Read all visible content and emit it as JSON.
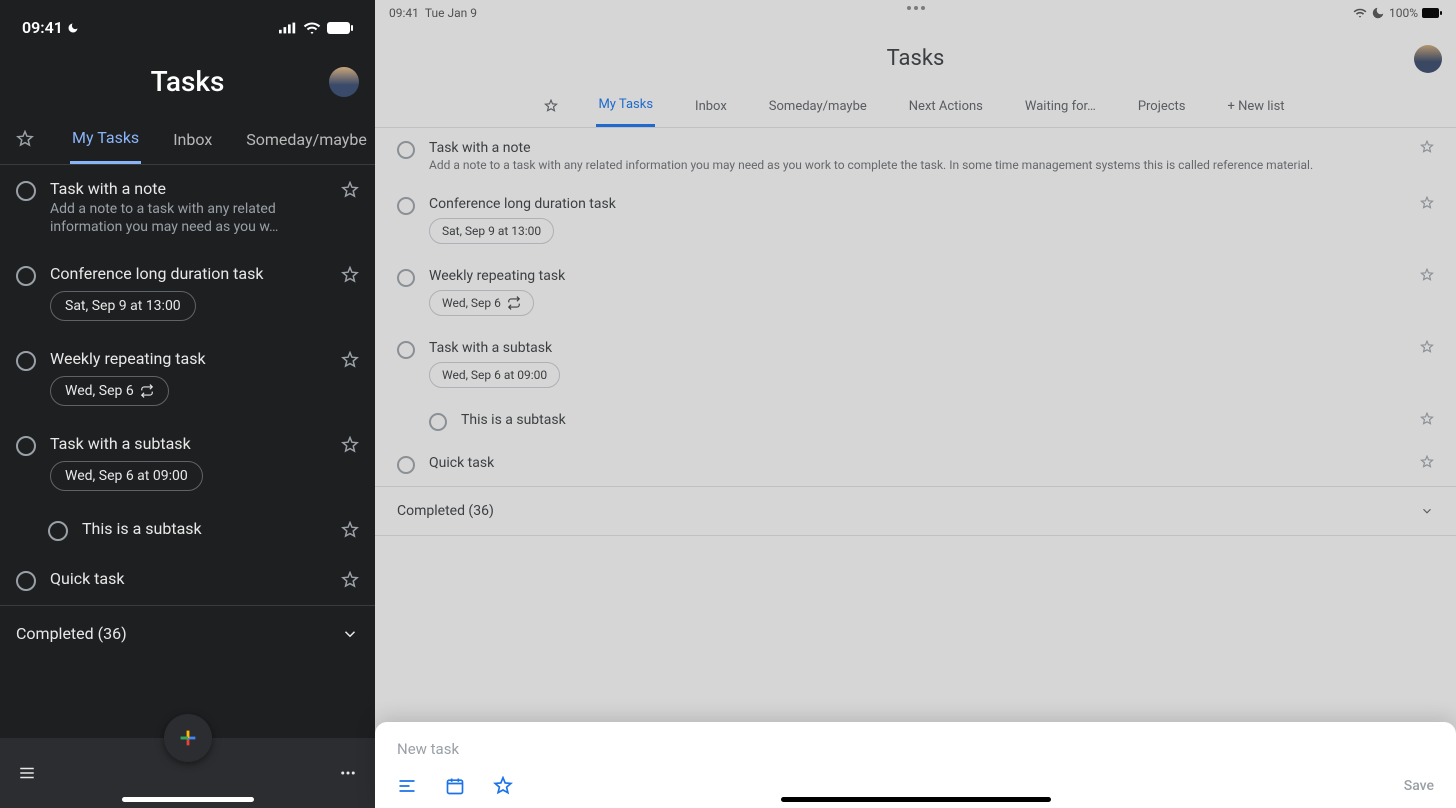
{
  "phone": {
    "statusbar": {
      "time": "09:41"
    },
    "header": {
      "title": "Tasks"
    },
    "tabs": [
      "My Tasks",
      "Inbox",
      "Someday/maybe"
    ],
    "tasks": [
      {
        "title": "Task with a note",
        "note": "Add a note to a task with any related information you may need as you w…"
      },
      {
        "title": "Conference long duration task",
        "chip": "Sat, Sep 9 at 13:00"
      },
      {
        "title": "Weekly repeating task",
        "chip": "Wed, Sep 6",
        "repeat": true
      },
      {
        "title": "Task with a subtask",
        "chip": "Wed, Sep 6 at 09:00"
      },
      {
        "title": "This is a subtask",
        "sub": true
      },
      {
        "title": "Quick task"
      }
    ],
    "completed": "Completed (36)"
  },
  "tablet": {
    "statusbar": {
      "time": "09:41",
      "date": "Tue Jan 9",
      "battery": "100%"
    },
    "header": {
      "title": "Tasks"
    },
    "tabs": [
      "My Tasks",
      "Inbox",
      "Someday/maybe",
      "Next Actions",
      "Waiting for…",
      "Projects",
      "+ New list"
    ],
    "tasks": [
      {
        "title": "Task with a note",
        "note": "Add a note to a task with any related information you may need as you work to complete the task. In some time management systems this is called reference material."
      },
      {
        "title": "Conference long duration task",
        "chip": "Sat, Sep 9 at 13:00"
      },
      {
        "title": "Weekly repeating task",
        "chip": "Wed, Sep 6",
        "repeat": true
      },
      {
        "title": "Task with a subtask",
        "chip": "Wed, Sep 6 at 09:00"
      },
      {
        "title": "This is a subtask",
        "sub": true
      },
      {
        "title": "Quick task"
      }
    ],
    "completed": "Completed (36)",
    "newtask": {
      "placeholder": "New task",
      "save": "Save"
    }
  }
}
